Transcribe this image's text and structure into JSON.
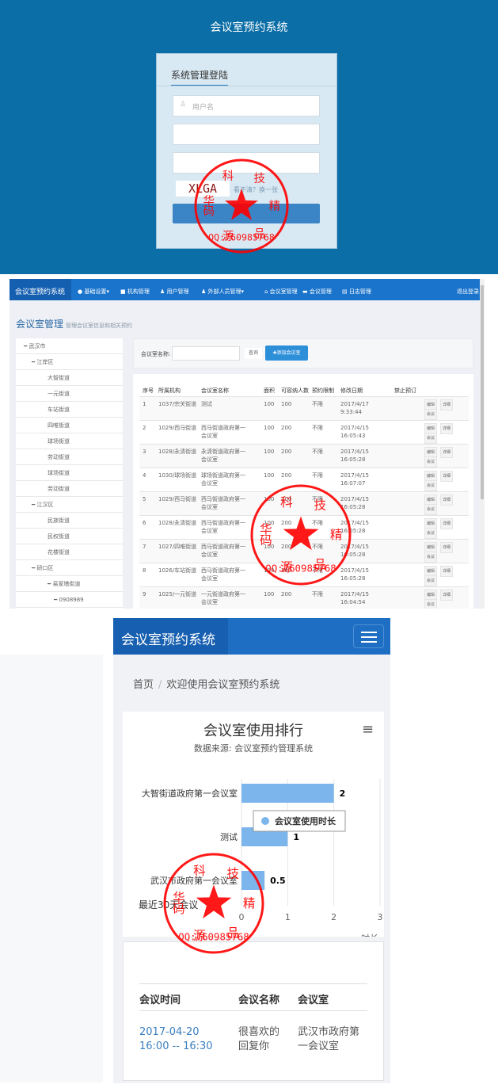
{
  "stamp": {
    "text": "QQ:760985768",
    "chars": "华科技精品源码",
    "color": "#ff0000"
  },
  "login_page": {
    "title": "会议室预约系统",
    "panel_title": "系统管理登陆",
    "username_placeholder": "用户名",
    "captcha": "XLGA",
    "captcha_link": "看不清？换一张",
    "bg_color": "#0b6ea6"
  },
  "admin_page": {
    "brand": "会议室预约系统",
    "nav": [
      "● 基础设置▾",
      "■ 机构管理",
      "♟ 用户管理",
      "♟ 外部人员管理▾",
      "⌂ 会议室管理",
      "▬ 会议管理",
      "▤ 日志管理"
    ],
    "logout": "退出登录",
    "page_title": "会议室管理",
    "page_subtitle": "管理会议室信息和相关预约",
    "tree": [
      {
        "label": "武汉市",
        "level": 0,
        "expanded": true
      },
      {
        "label": "江岸区",
        "level": 1,
        "expanded": true
      },
      {
        "label": "大智街道",
        "level": 2
      },
      {
        "label": "一元街道",
        "level": 2
      },
      {
        "label": "车站街道",
        "level": 2
      },
      {
        "label": "四唯街道",
        "level": 2
      },
      {
        "label": "球场街道",
        "level": 2
      },
      {
        "label": "劳动街道",
        "level": 2
      },
      {
        "label": "球场街道",
        "level": 2
      },
      {
        "label": "劳动街道",
        "level": 2
      },
      {
        "label": "江汉区",
        "level": 1,
        "expanded": true
      },
      {
        "label": "民族街道",
        "level": 2
      },
      {
        "label": "民权街道",
        "level": 2
      },
      {
        "label": "花楼街道",
        "level": 2
      },
      {
        "label": "硚口区",
        "level": 1,
        "expanded": true
      },
      {
        "label": "易家墩街道",
        "level": 2,
        "expanded": true
      },
      {
        "label": "0908989",
        "level": 3,
        "expanded": true
      }
    ],
    "search_label": "会议室名称:",
    "search_value": "",
    "search_button": "查询",
    "add_button": "✚添加会议室",
    "columns": [
      "序号",
      "所属机构",
      "会议室名称",
      "面积",
      "可容纳人数",
      "预约限制",
      "修改日期",
      "禁止预订"
    ],
    "rows": [
      [
        "1",
        "1037/宗关街道",
        "测试",
        "100",
        "100",
        "不限",
        "2017/4/17 9:33:44"
      ],
      [
        "2",
        "1029/西马街道",
        "西马街道政府第一会议室",
        "100",
        "200",
        "不限",
        "2017/4/15 16:05:43"
      ],
      [
        "3",
        "1028/永清街道",
        "永清街道政府第一会议室",
        "100",
        "200",
        "不限",
        "2017/4/15 16:05:28"
      ],
      [
        "4",
        "1030/球场街道",
        "球场街道政府第一会议室",
        "100",
        "200",
        "不限",
        "2017/4/15 16:07:07"
      ],
      [
        "5",
        "1029/西马街道",
        "西马街道政府第一会议室",
        "100",
        "200",
        "不限",
        "2017/4/15 16:05:28"
      ],
      [
        "6",
        "1028/永清街道",
        "西马街道政府第一会议室",
        "100",
        "200",
        "不限",
        "2017/4/15 16:05:28"
      ],
      [
        "7",
        "1027/四唯街道",
        "西马街道政府第一会议室",
        "100",
        "200",
        "不限",
        "2017/4/15 16:05:28"
      ],
      [
        "8",
        "1026/车站街道",
        "西马街道政府第一会议室",
        "100",
        "200",
        "不限",
        "2017/4/15 16:05:28"
      ],
      [
        "9",
        "1025/一元街道",
        "一元街道政府第一会议室",
        "100",
        "200",
        "不限",
        "2017/4/15 16:04:54"
      ]
    ],
    "row_actions": [
      "编辑",
      "详细",
      "会议"
    ]
  },
  "mobile_page": {
    "brand": "会议室预约系统",
    "breadcrumb": [
      "首页",
      "欢迎使用会议室预约系统"
    ],
    "section_label": "最近30天会议",
    "meetings": {
      "columns": [
        "会议时间",
        "会议名称",
        "会议室"
      ],
      "rows": [
        [
          "2017-04-20 16:00 -- 16:30",
          "很喜欢的回复你",
          "武汉市政府第一会议室"
        ]
      ]
    }
  },
  "chart_data": {
    "type": "bar",
    "orientation": "horizontal",
    "title": "会议室使用排行",
    "subtitle": "数据来源: 会议室预约管理系统",
    "categories": [
      "大智街道政府第一会议室",
      "测试",
      "武汉市政府第一会议室"
    ],
    "series": [
      {
        "name": "会议室使用时长",
        "values": [
          2,
          1,
          0.5
        ],
        "color": "#7cb5ec"
      }
    ],
    "xlabel": "时长",
    "xlim": [
      0,
      3
    ],
    "xticks": [
      "0",
      "1",
      "2",
      "3"
    ],
    "grid": true,
    "legend": "floating-center"
  }
}
